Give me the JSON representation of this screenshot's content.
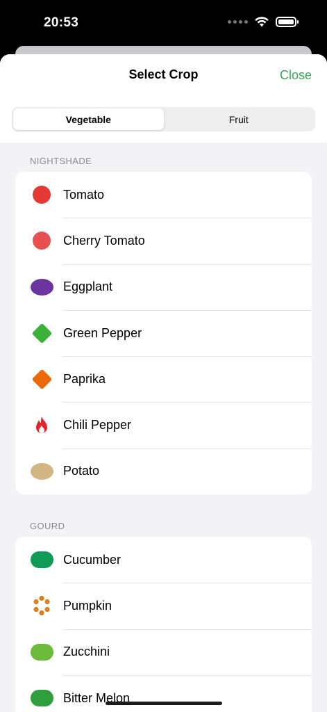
{
  "status": {
    "time": "20:53"
  },
  "sheet": {
    "title": "Select Crop",
    "close_label": "Close"
  },
  "segments": [
    {
      "label": "Vegetable",
      "selected": true
    },
    {
      "label": "Fruit",
      "selected": false
    }
  ],
  "colors": {
    "accent": "#34a853"
  },
  "sections": [
    {
      "header": "NIGHTSHADE",
      "items": [
        {
          "label": "Tomato",
          "icon": "circle-icon",
          "color": "#e53935"
        },
        {
          "label": "Cherry Tomato",
          "icon": "circle-icon",
          "color": "#e8504f"
        },
        {
          "label": "Eggplant",
          "icon": "oval-icon",
          "color": "#6a35a0"
        },
        {
          "label": "Green Pepper",
          "icon": "diamond-icon",
          "color": "#3cb13a"
        },
        {
          "label": "Paprika",
          "icon": "diamond-icon",
          "color": "#ea6a0a"
        },
        {
          "label": "Chili Pepper",
          "icon": "flame-icon",
          "color": "#e3262a"
        },
        {
          "label": "Potato",
          "icon": "oval-icon",
          "color": "#d2b683"
        }
      ]
    },
    {
      "header": "GOURD",
      "items": [
        {
          "label": "Cucumber",
          "icon": "pill-icon",
          "color": "#0f9a55"
        },
        {
          "label": "Pumpkin",
          "icon": "dots-ring-icon",
          "color": "#e07b1c"
        },
        {
          "label": "Zucchini",
          "icon": "pill-icon",
          "color": "#6dbb3a"
        },
        {
          "label": "Bitter Melon",
          "icon": "pill-icon",
          "color": "#2f9e3c"
        }
      ]
    }
  ]
}
